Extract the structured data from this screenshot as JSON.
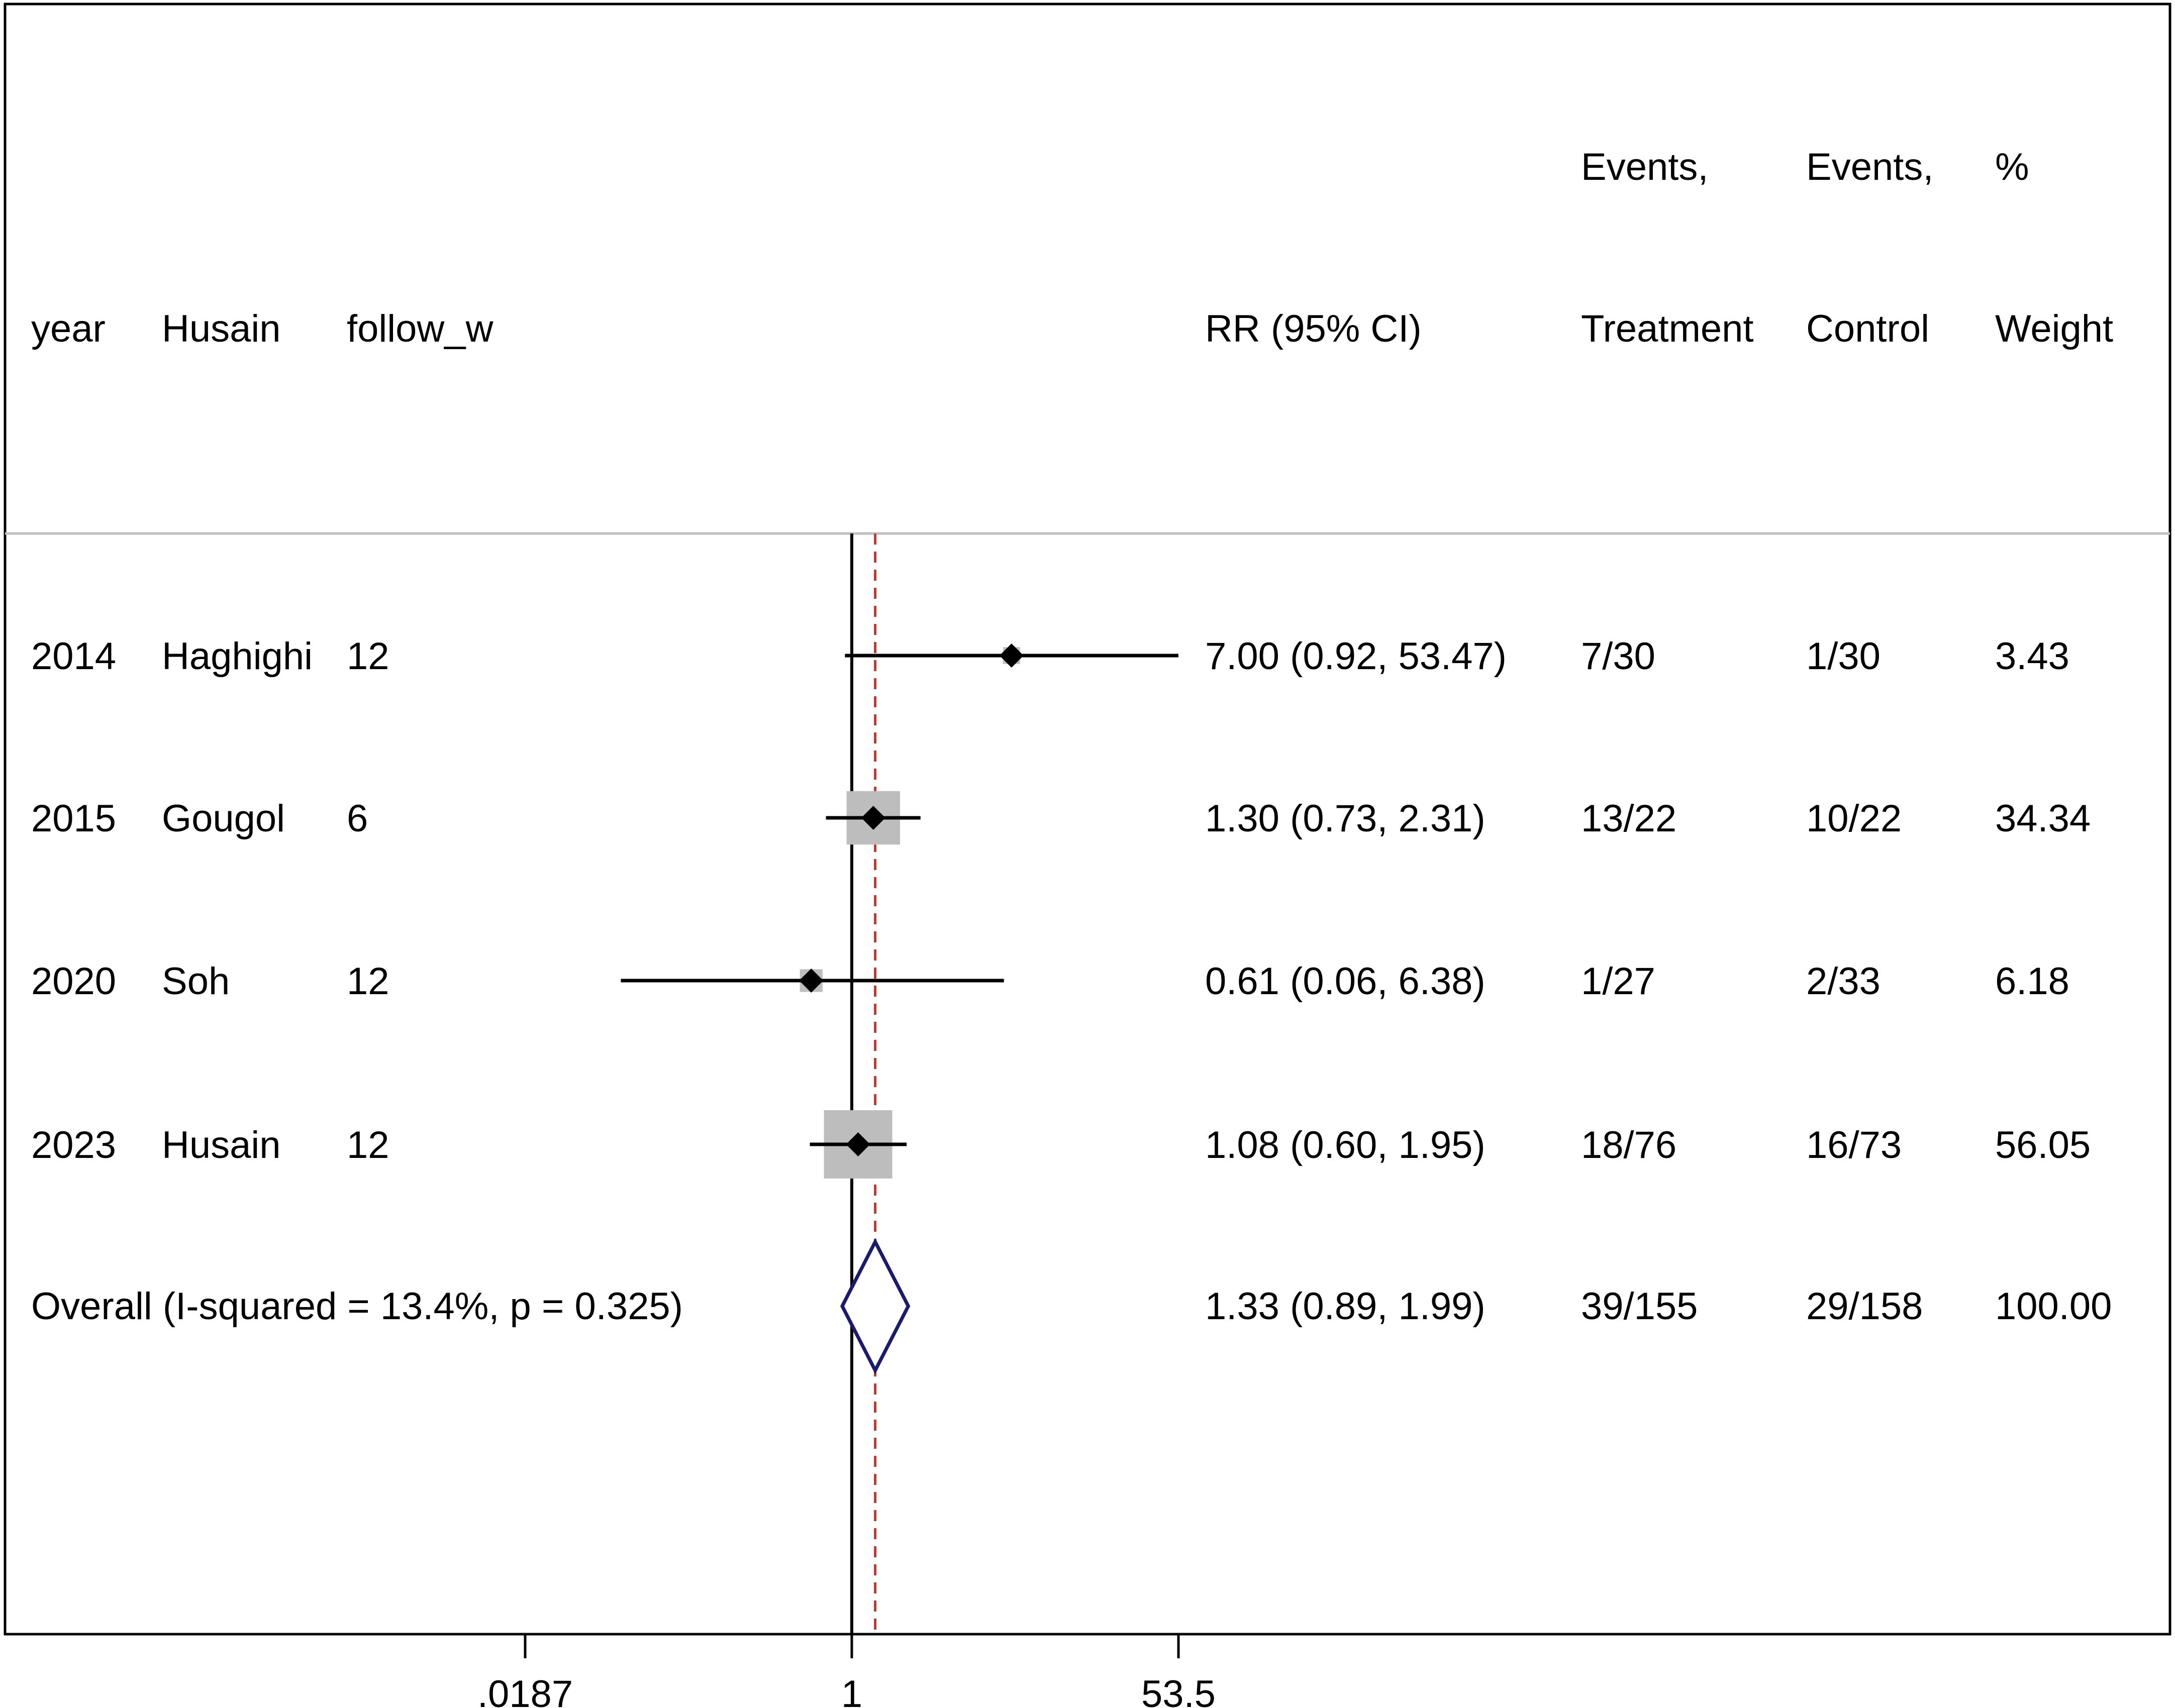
{
  "chart_data": {
    "type": "forest",
    "scale": "log",
    "xticks": [
      {
        "value": 0.0187,
        "label": ".0187"
      },
      {
        "value": 1,
        "label": "1"
      },
      {
        "value": 53.5,
        "label": "53.5"
      }
    ],
    "xlim": [
      0.0187,
      53.5
    ],
    "null_value": 1,
    "overall_value": 1.33,
    "grid": false,
    "columns": {
      "year": "year",
      "study": "Husain",
      "follow": "follow_w",
      "rr": "RR (95% CI)",
      "treat_top": "Events,",
      "treat_bottom": "Treatment",
      "ctrl_top": "Events,",
      "ctrl_bottom": "Control",
      "weight_top": "%",
      "weight_bottom": "Weight"
    },
    "studies": [
      {
        "year": "2014",
        "study": "Haghighi",
        "follow": "12",
        "rr": 7.0,
        "lo": 0.92,
        "hi": 53.47,
        "rr_text": "7.00 (0.92, 53.47)",
        "treatment": "7/30",
        "control": "1/30",
        "weight": 3.43,
        "weight_text": "3.43"
      },
      {
        "year": "2015",
        "study": "Gougol",
        "follow": "6",
        "rr": 1.3,
        "lo": 0.73,
        "hi": 2.31,
        "rr_text": "1.30 (0.73, 2.31)",
        "treatment": "13/22",
        "control": "10/22",
        "weight": 34.34,
        "weight_text": "34.34"
      },
      {
        "year": "2020",
        "study": "Soh",
        "follow": "12",
        "rr": 0.61,
        "lo": 0.06,
        "hi": 6.38,
        "rr_text": "0.61 (0.06, 6.38)",
        "treatment": "1/27",
        "control": "2/33",
        "weight": 6.18,
        "weight_text": "6.18"
      },
      {
        "year": "2023",
        "study": "Husain",
        "follow": "12",
        "rr": 1.08,
        "lo": 0.6,
        "hi": 1.95,
        "rr_text": "1.08 (0.60, 1.95)",
        "treatment": "18/76",
        "control": "16/73",
        "weight": 56.05,
        "weight_text": "56.05"
      }
    ],
    "overall": {
      "label": "Overall  (I-squared = 13.4%, p = 0.325)",
      "rr": 1.33,
      "lo": 0.89,
      "hi": 1.99,
      "rr_text": "1.33 (0.89, 1.99)",
      "treatment": "39/155",
      "control": "29/158",
      "weight_text": "100.00"
    },
    "colors": {
      "marker": "#000000",
      "weight_box": "#bdbdbd",
      "diamond": "#1a1a6e",
      "null_line": "#000000",
      "overall_line": "#c0392b",
      "separator": "#bfbfbf"
    }
  }
}
